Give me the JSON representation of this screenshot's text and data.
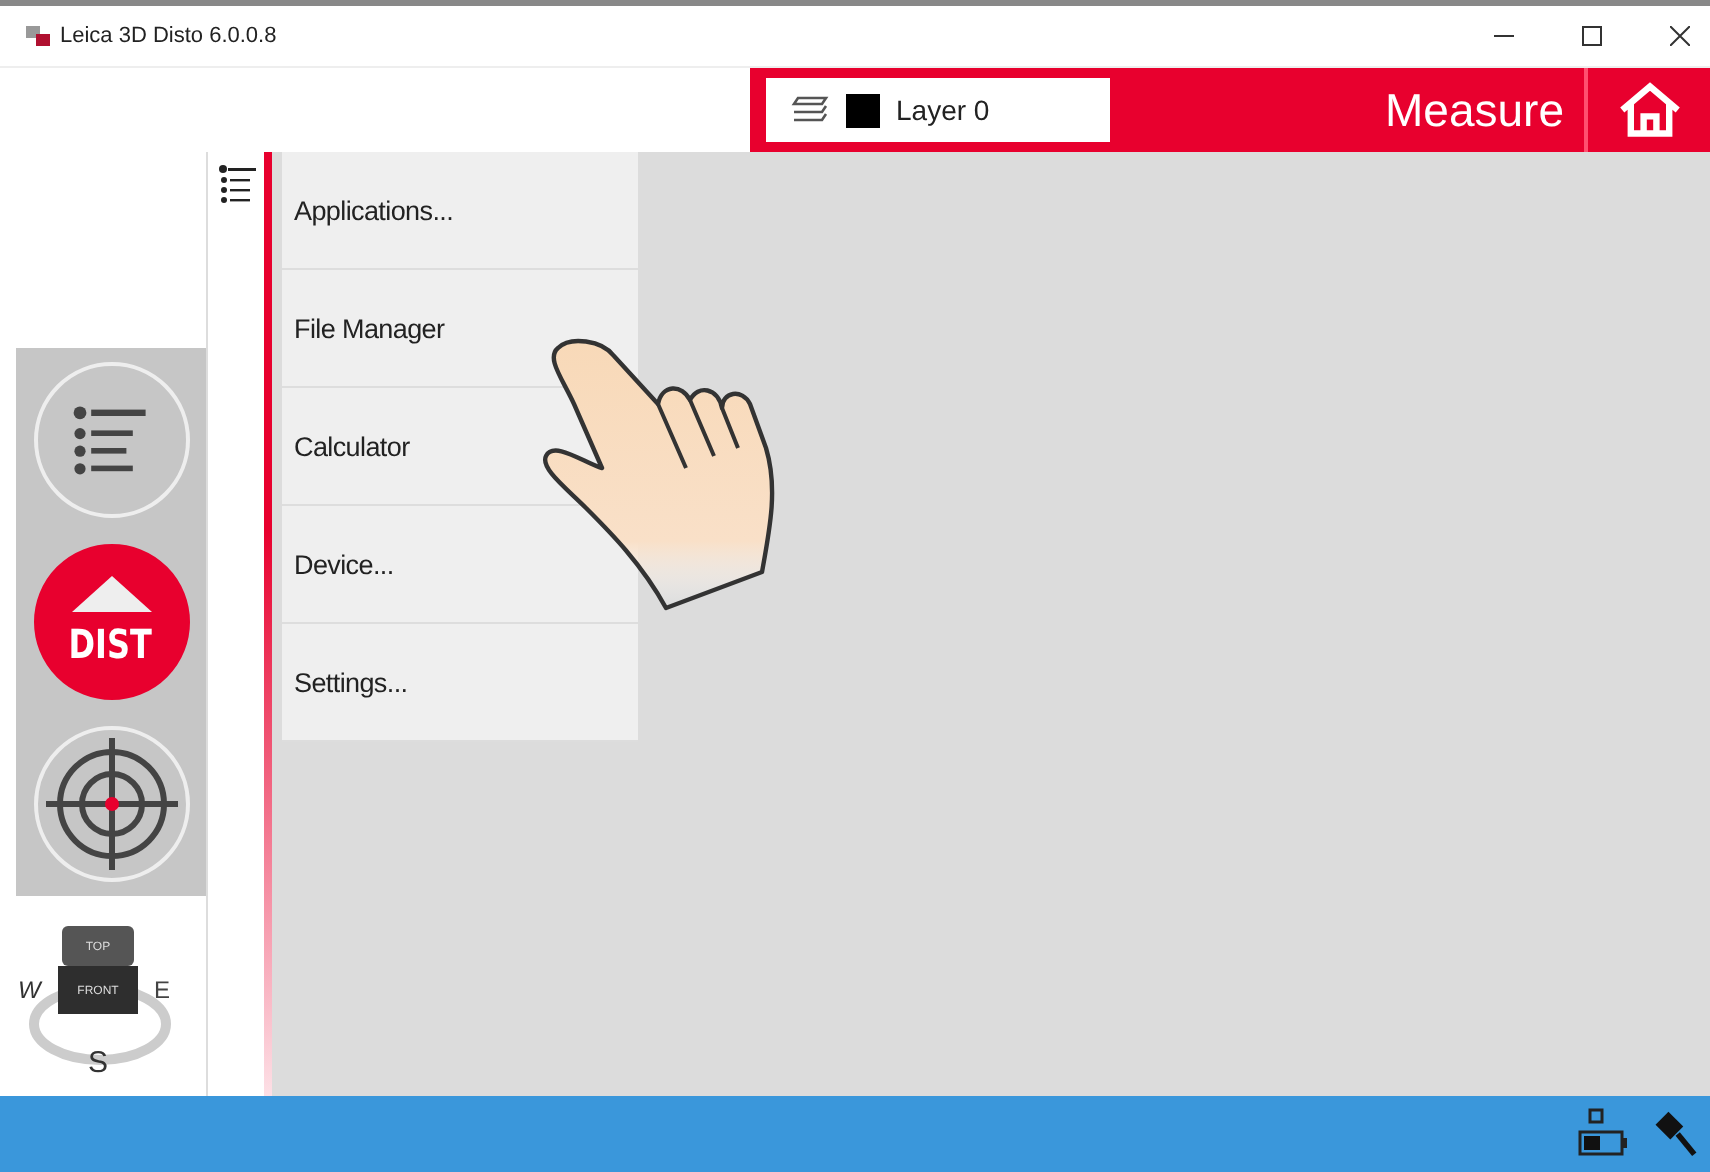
{
  "window": {
    "title": "Leica 3D Disto 6.0.0.8"
  },
  "header": {
    "layer": "Layer 0",
    "mode": "Measure"
  },
  "tools": [
    {
      "kind": "list"
    },
    {
      "kind": "dist",
      "label": "DIST"
    },
    {
      "kind": "target"
    }
  ],
  "compass": {
    "top": "TOP",
    "front": "FRONT",
    "west": "W",
    "east": "E",
    "south": "S"
  },
  "menu": [
    {
      "label": "Applications..."
    },
    {
      "label": "File Manager"
    },
    {
      "label": "Calculator"
    },
    {
      "label": "Device..."
    },
    {
      "label": "Settings..."
    }
  ]
}
